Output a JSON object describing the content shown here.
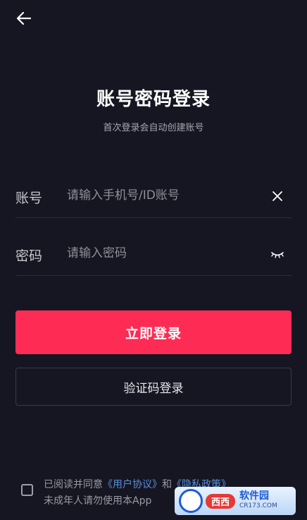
{
  "header": {
    "back_icon": "arrow-left-icon"
  },
  "title": "账号密码登录",
  "subtitle": "首次登录会自动创建账号",
  "account": {
    "label": "账号",
    "placeholder": "请输入手机号/ID账号",
    "clear_icon": "close-icon"
  },
  "password": {
    "label": "密码",
    "placeholder": "请输入密码",
    "toggle_icon": "eye-closed-icon"
  },
  "login_button": "立即登录",
  "code_login_button": "验证码登录",
  "agreement": {
    "prefix": "已阅读并同意",
    "user_agreement": "《用户协议》",
    "and": "和",
    "privacy_policy": "《隐私政策》",
    "notice": "未成年人请勿使用本App"
  },
  "watermark": {
    "badge": "西西",
    "name": "软件园",
    "domain": "CR173.COM"
  },
  "colors": {
    "background": "#161622",
    "primary": "#fe2c55",
    "link": "#5b8fd8"
  }
}
